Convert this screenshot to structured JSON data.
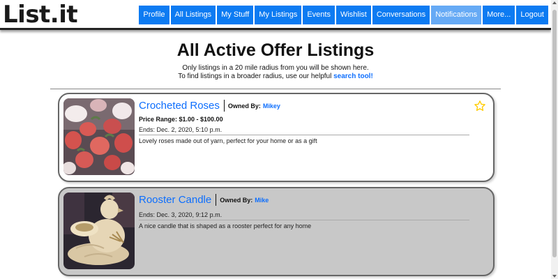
{
  "app": {
    "logo": "List.it"
  },
  "nav": {
    "items": [
      "Profile",
      "All Listings",
      "My Stuff",
      "My Listings",
      "Events",
      "Wishlist",
      "Conversations",
      "Notifications",
      "More...",
      "Logout"
    ]
  },
  "header": {
    "title": "All Active Offer Listings",
    "subtitle_line1": "Only listings in a 20 mile radius from you will be shown here.",
    "subtitle_line2_prefix": "To find listings in a broader radius, use our helpful ",
    "search_tool_link": "search tool!"
  },
  "listings": [
    {
      "title": "Crocheted Roses",
      "owner_label": "Owned By:",
      "owner": "Mikey",
      "price_range": "Price Range: $1.00 - $100.00",
      "ends": "Ends: Dec. 2, 2020, 5:10 p.m.",
      "description": "Lovely roses made out of yarn, perfect for your home or as a gift",
      "favorite_icon": "star-outline-icon",
      "accent": "#ffcc00"
    },
    {
      "title": "Rooster Candle",
      "owner_label": "Owned By:",
      "owner": "Mike",
      "ends": "Ends: Dec. 3, 2020, 9:12 p.m.",
      "description": "A nice candle that is shaped as a rooster perfect for any home"
    }
  ],
  "colors": {
    "nav_bg": "#0d7bf2",
    "nav_active": "#66aaf5",
    "link": "#0d6efd"
  }
}
